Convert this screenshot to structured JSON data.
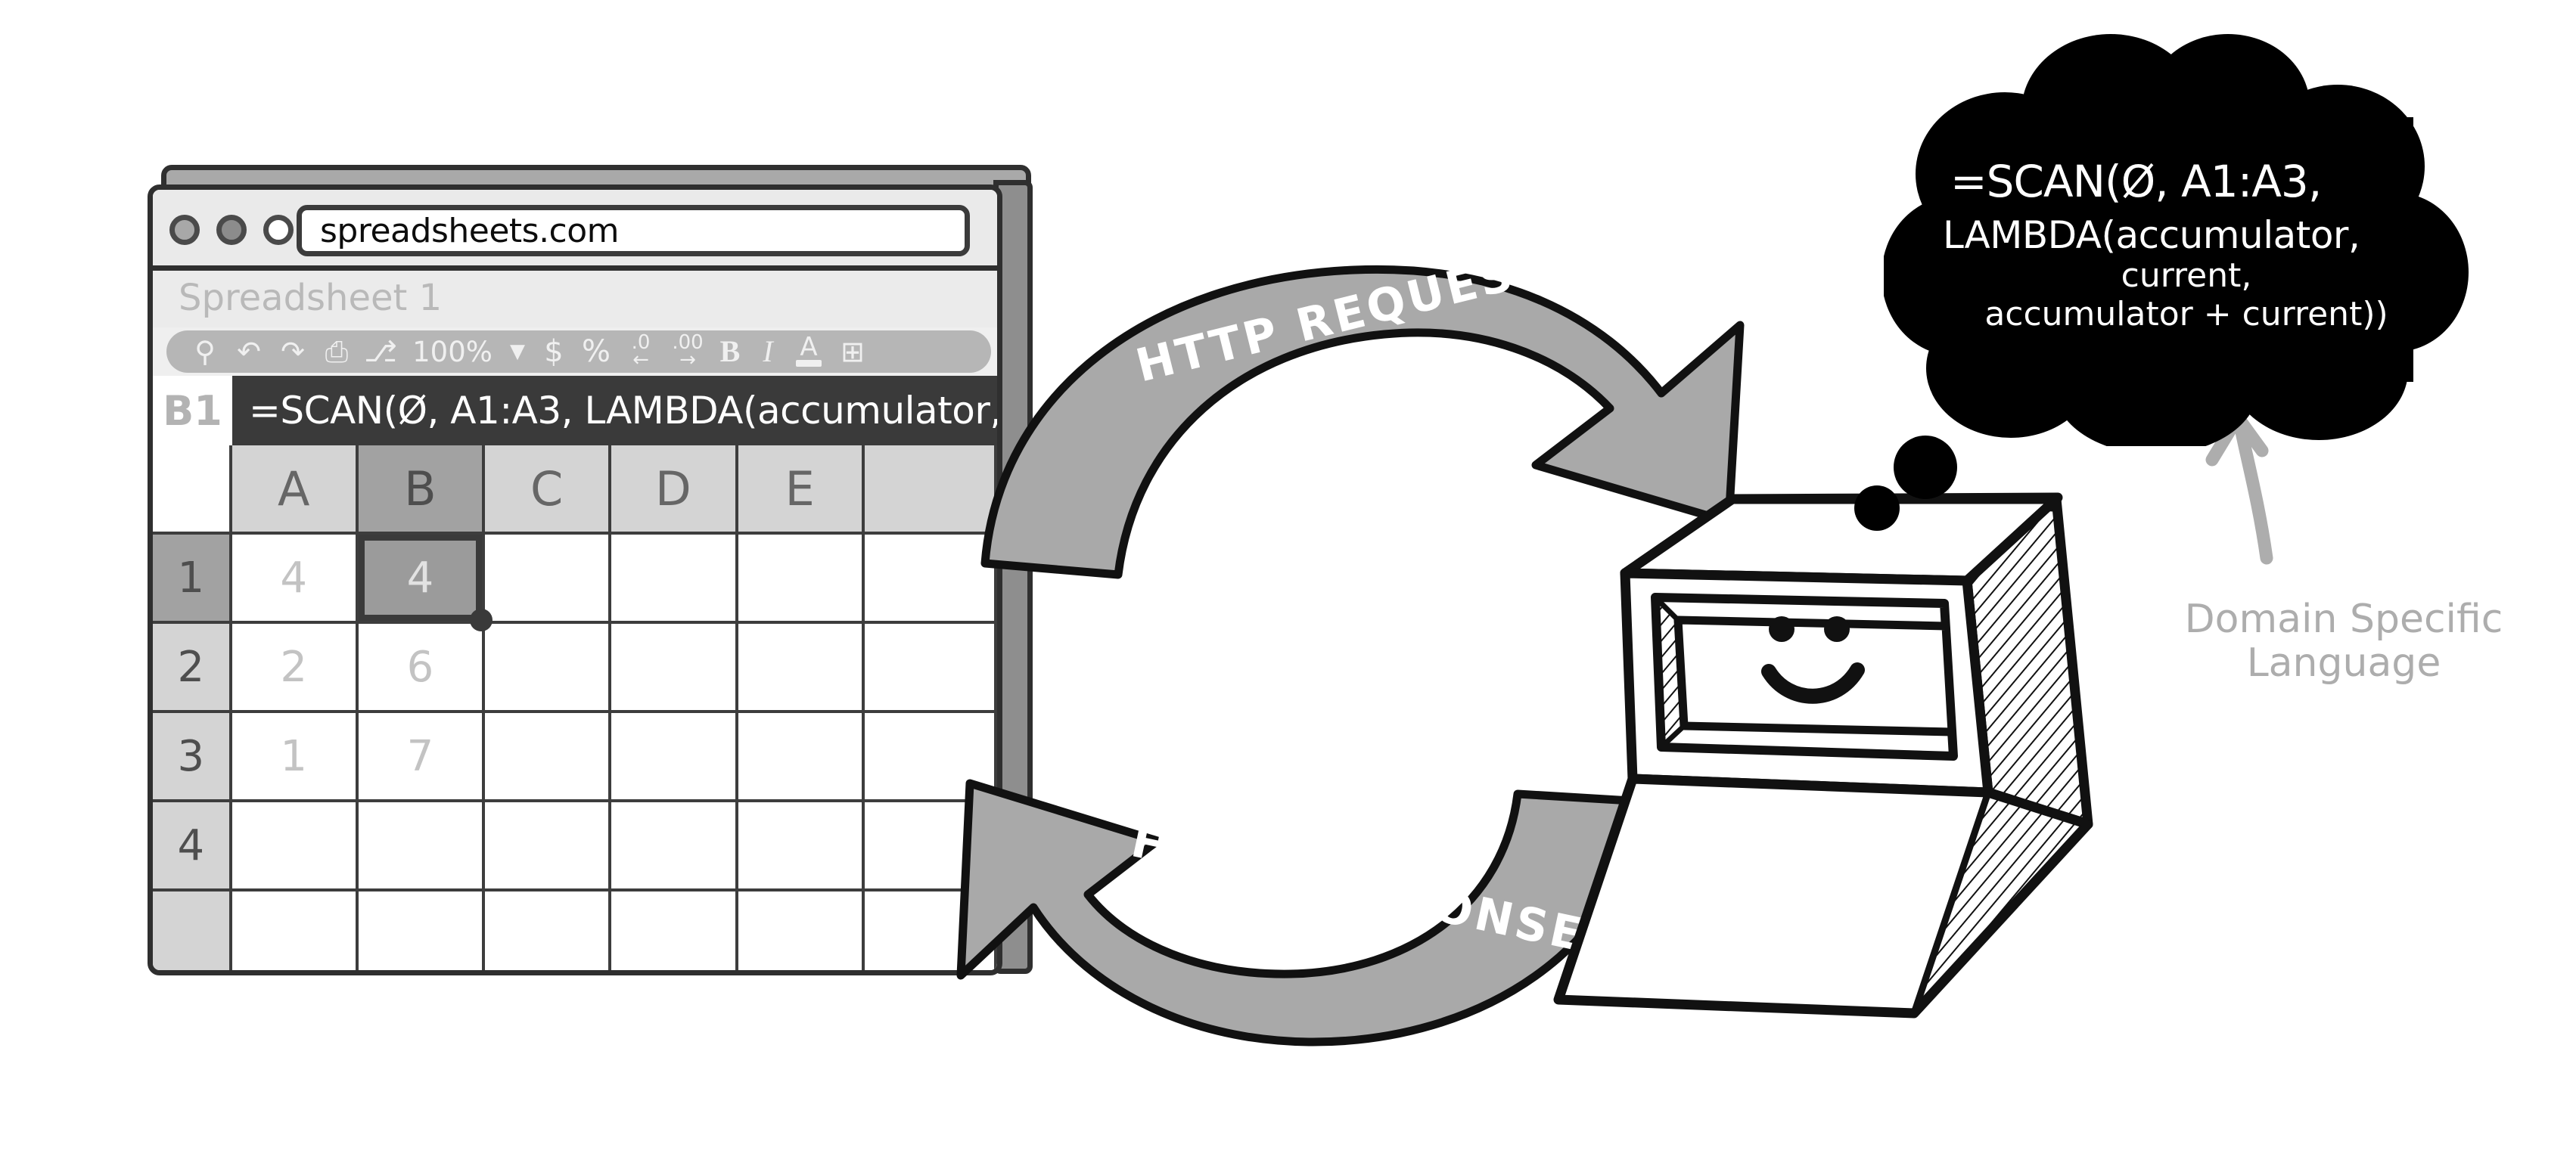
{
  "browser": {
    "traffic_lights": [
      "close-dot",
      "minimize-dot",
      "maximize-dot"
    ],
    "url": "spreadsheets.com",
    "app_title": "Spreadsheet 1",
    "toolbar": [
      {
        "name": "search-icon",
        "glyph": "⚲",
        "kind": "ic"
      },
      {
        "name": "undo-icon",
        "glyph": "↶",
        "kind": "ic"
      },
      {
        "name": "redo-icon",
        "glyph": "↷",
        "kind": "ic"
      },
      {
        "name": "print-icon",
        "glyph": "⎙",
        "kind": "ic"
      },
      {
        "name": "paint-format-icon",
        "glyph": "⎇",
        "kind": "ic"
      },
      {
        "name": "zoom-level",
        "glyph": "100%",
        "kind": "zoom"
      },
      {
        "name": "chevron-down-icon",
        "glyph": "▼",
        "kind": "caret"
      },
      {
        "name": "currency-format-icon",
        "glyph": "$",
        "kind": "sym"
      },
      {
        "name": "percent-format-icon",
        "glyph": "%",
        "kind": "sym"
      },
      {
        "name": "decrease-decimal-icon",
        "glyph": ".0",
        "sub": "←",
        "kind": "dec"
      },
      {
        "name": "increase-decimal-icon",
        "glyph": ".00",
        "sub": "→",
        "kind": "dec"
      },
      {
        "name": "bold-icon",
        "glyph": "B",
        "kind": "bold"
      },
      {
        "name": "italic-icon",
        "glyph": "I",
        "kind": "ital"
      },
      {
        "name": "text-color-icon",
        "glyph": "A",
        "kind": "tcol"
      },
      {
        "name": "borders-icon",
        "glyph": "⊞",
        "kind": "ic"
      }
    ],
    "formula_bar": {
      "cell_reference": "B1",
      "formula": "=SCAN(Ø, A1:A3, LAMBDA(accumulator,"
    },
    "sheet": {
      "column_headers": [
        "",
        "A",
        "B",
        "C",
        "D",
        "E",
        ""
      ],
      "selected_column": "B",
      "selected_row": "1",
      "selected_cell": "B1",
      "rows": [
        {
          "header": "1",
          "cells": [
            "4",
            "4",
            "",
            "",
            "",
            ""
          ]
        },
        {
          "header": "2",
          "cells": [
            "2",
            "6",
            "",
            "",
            "",
            ""
          ]
        },
        {
          "header": "3",
          "cells": [
            "1",
            "7",
            "",
            "",
            "",
            ""
          ]
        },
        {
          "header": "4",
          "cells": [
            "",
            "",
            "",
            "",
            "",
            ""
          ]
        },
        {
          "header": "",
          "cells": [
            "",
            "",
            "",
            "",
            "",
            ""
          ]
        }
      ]
    }
  },
  "flow": {
    "request_label": "HTTP REQUEST",
    "response_label": "HTTP RESPONSE"
  },
  "thought_bubble": {
    "line1": "=SCAN(Ø, A1:A3,",
    "line2": "LAMBDA(accumulator,",
    "line3": "current,",
    "line4": "accumulator + current))"
  },
  "annotation": {
    "dsl_label_line1": "Domain Specific",
    "dsl_label_line2": "Language"
  },
  "colors": {
    "ink": "#111111",
    "arrow_fill": "#a9a9a9",
    "bubble_fill": "#000000",
    "annotation_gray": "#adadad",
    "formula_bar_bg": "#3a3a3a",
    "header_gray": "#d4d4d4",
    "selected_gray": "#a2a2a2"
  }
}
